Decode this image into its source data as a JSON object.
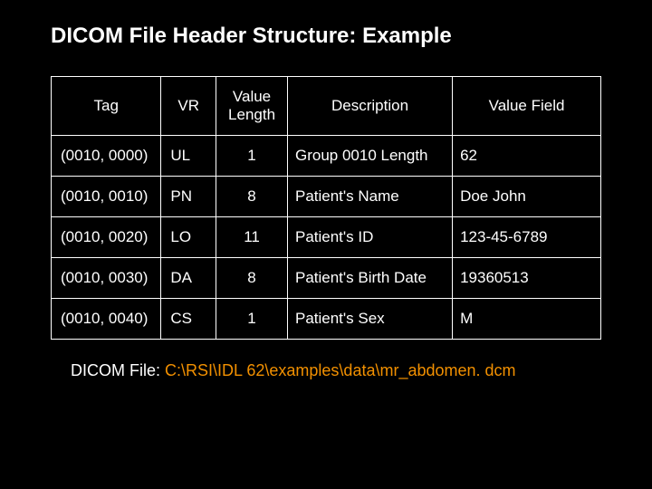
{
  "title": "DICOM File Header Structure: Example",
  "headers": {
    "tag": "Tag",
    "vr": "VR",
    "value_length": "Value Length",
    "description": "Description",
    "value_field": "Value Field"
  },
  "rows": [
    {
      "tag": "(0010, 0000)",
      "vr": "UL",
      "value_length": "1",
      "description": "Group 0010 Length",
      "value_field": "62"
    },
    {
      "tag": "(0010, 0010)",
      "vr": "PN",
      "value_length": "8",
      "description": "Patient's Name",
      "value_field": "Doe John"
    },
    {
      "tag": "(0010, 0020)",
      "vr": "LO",
      "value_length": "11",
      "description": "Patient's ID",
      "value_field": "123-45-6789"
    },
    {
      "tag": "(0010, 0030)",
      "vr": "DA",
      "value_length": "8",
      "description": "Patient's Birth Date",
      "value_field": "19360513"
    },
    {
      "tag": "(0010, 0040)",
      "vr": "CS",
      "value_length": "1",
      "description": "Patient's Sex",
      "value_field": "M"
    }
  ],
  "footer": {
    "label": "DICOM File: ",
    "path": "C:\\RSI\\IDL 62\\examples\\data\\mr_abdomen. dcm"
  },
  "chart_data": {
    "type": "table",
    "title": "DICOM File Header Structure: Example",
    "columns": [
      "Tag",
      "VR",
      "Value Length",
      "Description",
      "Value Field"
    ],
    "rows": [
      [
        "(0010, 0000)",
        "UL",
        1,
        "Group 0010 Length",
        "62"
      ],
      [
        "(0010, 0010)",
        "PN",
        8,
        "Patient's Name",
        "Doe John"
      ],
      [
        "(0010, 0020)",
        "LO",
        11,
        "Patient's ID",
        "123-45-6789"
      ],
      [
        "(0010, 0030)",
        "DA",
        8,
        "Patient's Birth Date",
        "19360513"
      ],
      [
        "(0010, 0040)",
        "CS",
        1,
        "Patient's Sex",
        "M"
      ]
    ]
  }
}
